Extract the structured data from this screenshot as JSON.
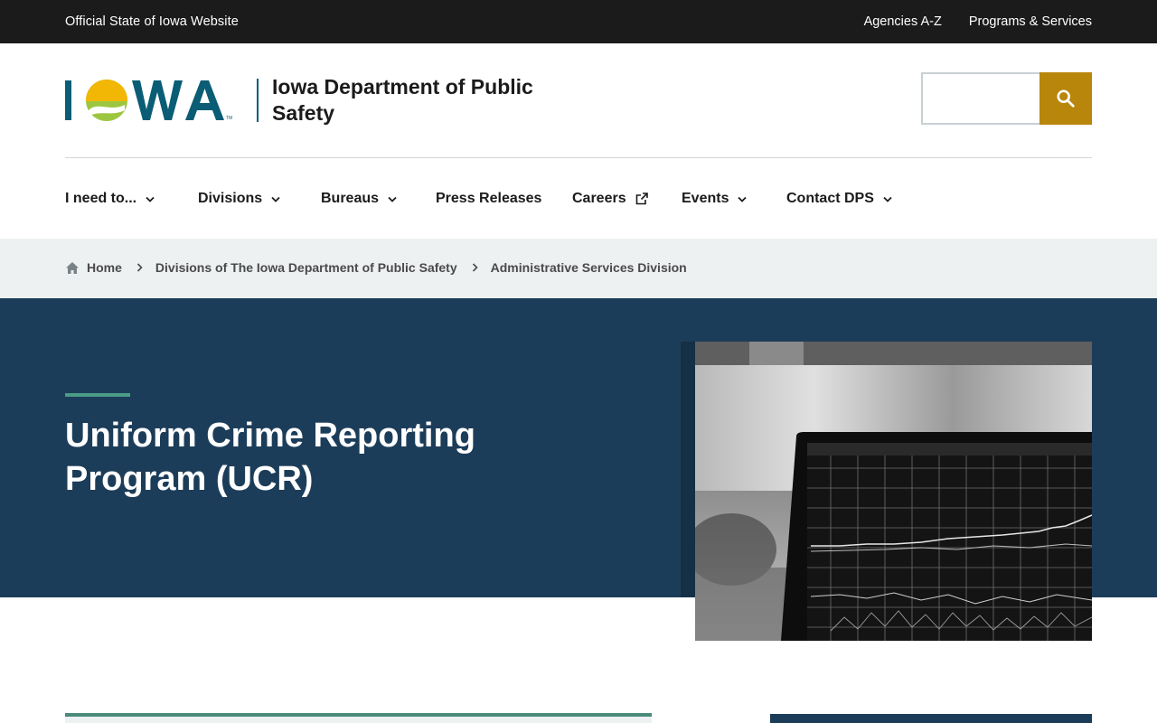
{
  "utility": {
    "official": "Official State of Iowa Website",
    "links": [
      "Agencies A-Z",
      "Programs & Services"
    ]
  },
  "header": {
    "logo_text": "IOWA",
    "department": "Iowa Department of Public Safety",
    "search_placeholder": ""
  },
  "nav": {
    "items": [
      {
        "label": "I need to...",
        "dropdown": true
      },
      {
        "label": "Divisions",
        "dropdown": true
      },
      {
        "label": "Bureaus",
        "dropdown": true
      },
      {
        "label": "Press Releases",
        "dropdown": false
      },
      {
        "label": "Careers",
        "external": true
      },
      {
        "label": "Events",
        "dropdown": true
      },
      {
        "label": "Contact DPS",
        "dropdown": true
      }
    ]
  },
  "breadcrumb": {
    "items": [
      "Home",
      "Divisions of The Iowa Department of Public Safety",
      "Administrative Services Division"
    ]
  },
  "hero": {
    "title": "Uniform Crime Reporting Program (UCR)"
  },
  "colors": {
    "utility_bg": "#1b1b1b",
    "hero_bg": "#1c3d59",
    "search_button": "#b8860b",
    "accent": "#4a9c86",
    "logo_blue": "#0a5d75",
    "logo_gold": "#f2b705",
    "logo_green": "#9cc63f"
  },
  "icons": {
    "search": "search-icon",
    "home": "home-icon",
    "chevron": "chevron-down-icon",
    "external": "external-link-icon",
    "separator": "chevron-right-icon"
  }
}
